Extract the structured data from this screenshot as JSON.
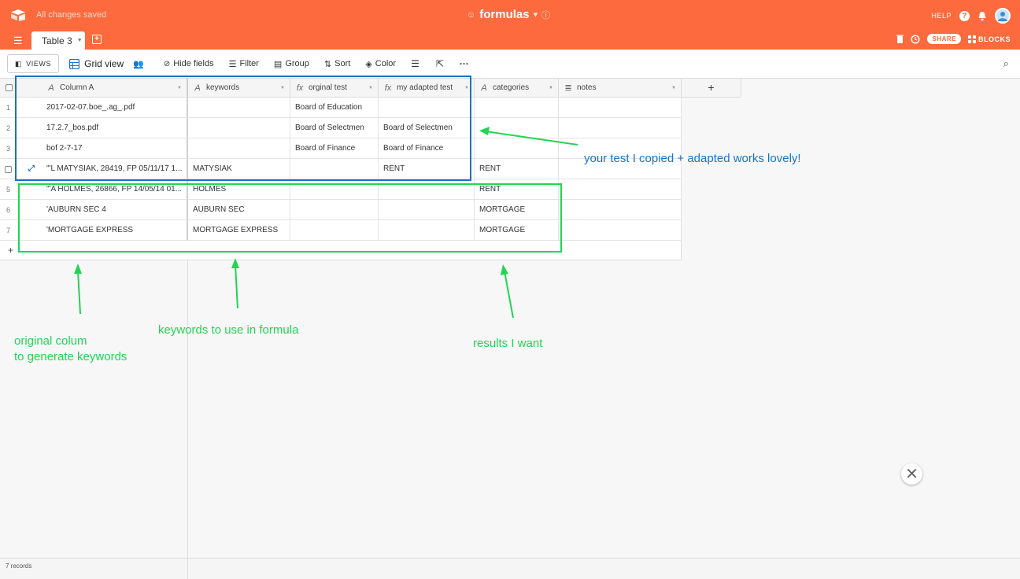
{
  "header": {
    "saved_status": "All changes saved",
    "base_name": "formulas",
    "help": "HELP",
    "help_q": "?"
  },
  "tabs": {
    "active": "Table 3",
    "share": "SHARE",
    "blocks": "BLOCKS"
  },
  "toolbar": {
    "views": "VIEWS",
    "grid_view": "Grid view",
    "hide_fields": "Hide fields",
    "filter": "Filter",
    "group": "Group",
    "sort": "Sort",
    "color": "Color"
  },
  "grid": {
    "columns": [
      {
        "label": "Column A",
        "icon": "text-field-icon"
      },
      {
        "label": "keywords",
        "icon": "text-field-icon"
      },
      {
        "label": "orginal test",
        "icon": "formula-icon"
      },
      {
        "label": "my adapted test",
        "icon": "formula-icon"
      },
      {
        "label": "categories",
        "icon": "text-field-icon"
      },
      {
        "label": "notes",
        "icon": "long-text-icon"
      }
    ],
    "rows": [
      {
        "num": "1",
        "cells": [
          "2017-02-07.boe_.ag_.pdf",
          "",
          "Board of Education",
          "",
          "",
          ""
        ]
      },
      {
        "num": "2",
        "cells": [
          "17.2.7_bos.pdf",
          "",
          "Board of Selectmen",
          "Board of Selectmen",
          "",
          ""
        ]
      },
      {
        "num": "3",
        "cells": [
          "bof 2-7-17",
          "",
          "Board of Finance",
          "Board of Finance",
          "",
          ""
        ]
      },
      {
        "num": "",
        "cells": [
          "\"'L MATYSIAK, 28419, FP 05/11/17 1...",
          "MATYSIAK",
          "",
          "RENT",
          "RENT",
          ""
        ]
      },
      {
        "num": "5",
        "cells": [
          "\"'A HOLMES, 26866, FP 14/05/14 01...",
          "HOLMES",
          "",
          "",
          "RENT",
          ""
        ]
      },
      {
        "num": "6",
        "cells": [
          "'AUBURN SEC 4",
          "AUBURN SEC",
          "",
          "",
          "MORTGAGE",
          ""
        ]
      },
      {
        "num": "7",
        "cells": [
          "'MORTGAGE EXPRESS",
          "MORTGAGE EXPRESS",
          "",
          "",
          "MORTGAGE",
          ""
        ]
      }
    ],
    "add_row": "+",
    "add_column": "+"
  },
  "footer": {
    "records": "7 records"
  },
  "annotations": {
    "blue_note": "your test I copied + adapted works lovely!",
    "original_colum_1": "original colum",
    "original_colum_2": "to generate keywords",
    "keywords_note": "keywords to use in formula",
    "results_note": "results I want"
  },
  "colors": {
    "brand": "#fc6a3d",
    "annotation_green": "#22d455",
    "annotation_blue": "#1874c5"
  }
}
